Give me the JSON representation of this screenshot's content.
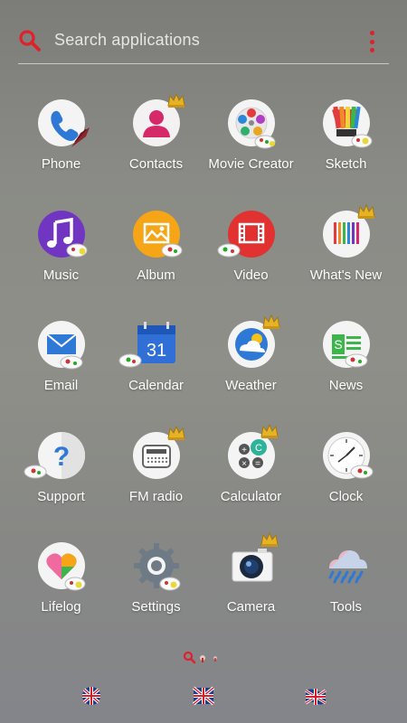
{
  "search": {
    "placeholder": "Search applications"
  },
  "apps": [
    {
      "label": "Phone",
      "icon": "phone-icon"
    },
    {
      "label": "Contacts",
      "icon": "contacts-icon"
    },
    {
      "label": "Movie Creator",
      "icon": "movie-creator-icon"
    },
    {
      "label": "Sketch",
      "icon": "sketch-icon"
    },
    {
      "label": "Music",
      "icon": "music-icon"
    },
    {
      "label": "Album",
      "icon": "album-icon"
    },
    {
      "label": "Video",
      "icon": "video-icon"
    },
    {
      "label": "What's New",
      "icon": "whats-new-icon"
    },
    {
      "label": "Email",
      "icon": "email-icon"
    },
    {
      "label": "Calendar",
      "icon": "calendar-icon",
      "day": "31"
    },
    {
      "label": "Weather",
      "icon": "weather-icon"
    },
    {
      "label": "News",
      "icon": "news-icon"
    },
    {
      "label": "Support",
      "icon": "support-icon"
    },
    {
      "label": "FM radio",
      "icon": "fm-radio-icon"
    },
    {
      "label": "Calculator",
      "icon": "calculator-icon"
    },
    {
      "label": "Clock",
      "icon": "clock-icon"
    },
    {
      "label": "Lifelog",
      "icon": "lifelog-icon"
    },
    {
      "label": "Settings",
      "icon": "settings-icon"
    },
    {
      "label": "Camera",
      "icon": "camera-icon"
    },
    {
      "label": "Tools",
      "icon": "tools-icon"
    }
  ],
  "colors": {
    "accent": "#e0202a",
    "label": "#ffffff"
  }
}
